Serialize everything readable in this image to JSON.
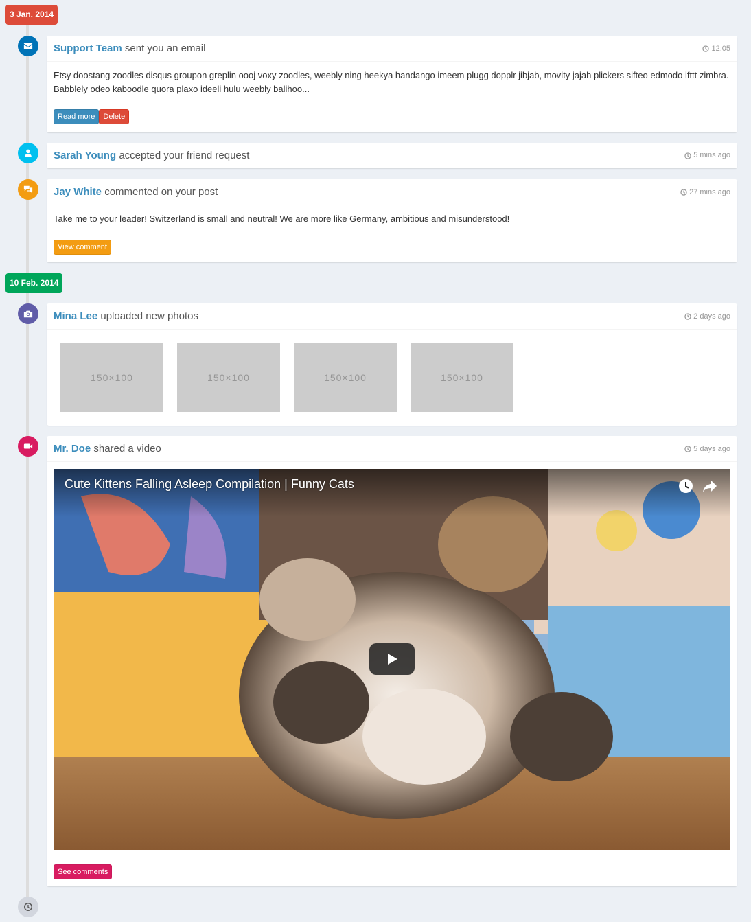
{
  "labels": {
    "date1": "3 Jan. 2014",
    "date2": "10 Feb. 2014"
  },
  "items": [
    {
      "author": "Support Team",
      "action": "sent you an email",
      "time": "12:05",
      "body": "Etsy doostang zoodles disqus groupon greplin oooj voxy zoodles, weebly ning heekya handango imeem plugg dopplr jibjab, movity jajah plickers sifteo edmodo ifttt zimbra. Babblely odeo kaboodle quora plaxo ideeli hulu weebly balihoo...",
      "buttons": [
        "Read more",
        "Delete"
      ]
    },
    {
      "author": "Sarah Young",
      "action": "accepted your friend request",
      "time": "5 mins ago"
    },
    {
      "author": "Jay White",
      "action": "commented on your post",
      "time": "27 mins ago",
      "body": "Take me to your leader! Switzerland is small and neutral! We are more like Germany, ambitious and misunderstood!",
      "buttons": [
        "View comment"
      ]
    },
    {
      "author": "Mina Lee",
      "action": "uploaded new photos",
      "time": "2 days ago",
      "photos": [
        "150×100",
        "150×100",
        "150×100",
        "150×100"
      ]
    },
    {
      "author": "Mr. Doe",
      "action": "shared a video",
      "time": "5 days ago",
      "video_title": "Cute Kittens Falling Asleep Compilation | Funny Cats",
      "buttons": [
        "See comments"
      ]
    }
  ],
  "icons": [
    "envelope-icon",
    "user-icon",
    "comments-icon",
    "camera-icon",
    "video-camera-icon",
    "clock-icon"
  ],
  "colors": {
    "background": "#ecf0f5",
    "red": "#dd4b39",
    "green": "#00a65a",
    "blue": "#0073b7",
    "aqua": "#00c0ef",
    "yellow": "#f39c12",
    "purple": "#605ca8",
    "maroon": "#d81b60",
    "link": "#3c8dbc"
  }
}
